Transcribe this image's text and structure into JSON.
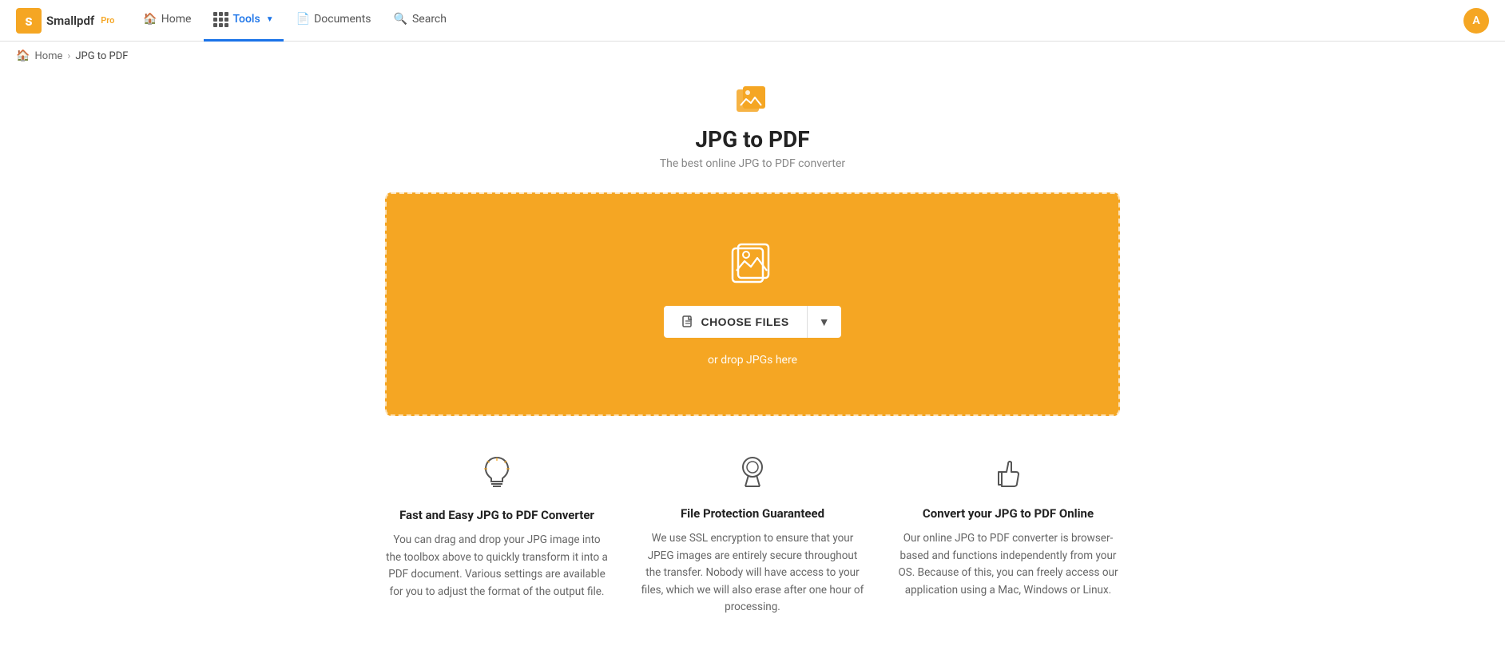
{
  "header": {
    "logo_text": "Smallpdf",
    "pro_label": "Pro",
    "nav": [
      {
        "id": "home",
        "label": "Home",
        "icon": "🏠",
        "active": false
      },
      {
        "id": "tools",
        "label": "Tools",
        "icon": "grid",
        "active": true,
        "dropdown": true
      },
      {
        "id": "documents",
        "label": "Documents",
        "icon": "📄",
        "active": false
      },
      {
        "id": "search",
        "label": "Search",
        "icon": "🔍",
        "active": false
      }
    ],
    "avatar_initial": "A"
  },
  "breadcrumb": {
    "home_label": "Home",
    "current_label": "JPG to PDF"
  },
  "page": {
    "icon": "🖼️",
    "title": "JPG to PDF",
    "subtitle": "The best online JPG to PDF converter"
  },
  "dropzone": {
    "choose_files_label": "CHOOSE FILES",
    "drop_hint": "or drop JPGs here"
  },
  "features": [
    {
      "id": "fast",
      "icon": "lightbulb",
      "title": "Fast and Easy JPG to PDF Converter",
      "desc": "You can drag and drop your JPG image into the toolbox above to quickly transform it into a PDF document. Various settings are available for you to adjust the format of the output file."
    },
    {
      "id": "protection",
      "icon": "shield",
      "title": "File Protection Guaranteed",
      "desc": "We use SSL encryption to ensure that your JPEG images are entirely secure throughout the transfer. Nobody will have access to your files, which we will also erase after one hour of processing."
    },
    {
      "id": "online",
      "icon": "thumbsup",
      "title": "Convert your JPG to PDF Online",
      "desc": "Our online JPG to PDF converter is browser-based and functions independently from your OS. Because of this, you can freely access our application using a Mac, Windows or Linux."
    }
  ]
}
